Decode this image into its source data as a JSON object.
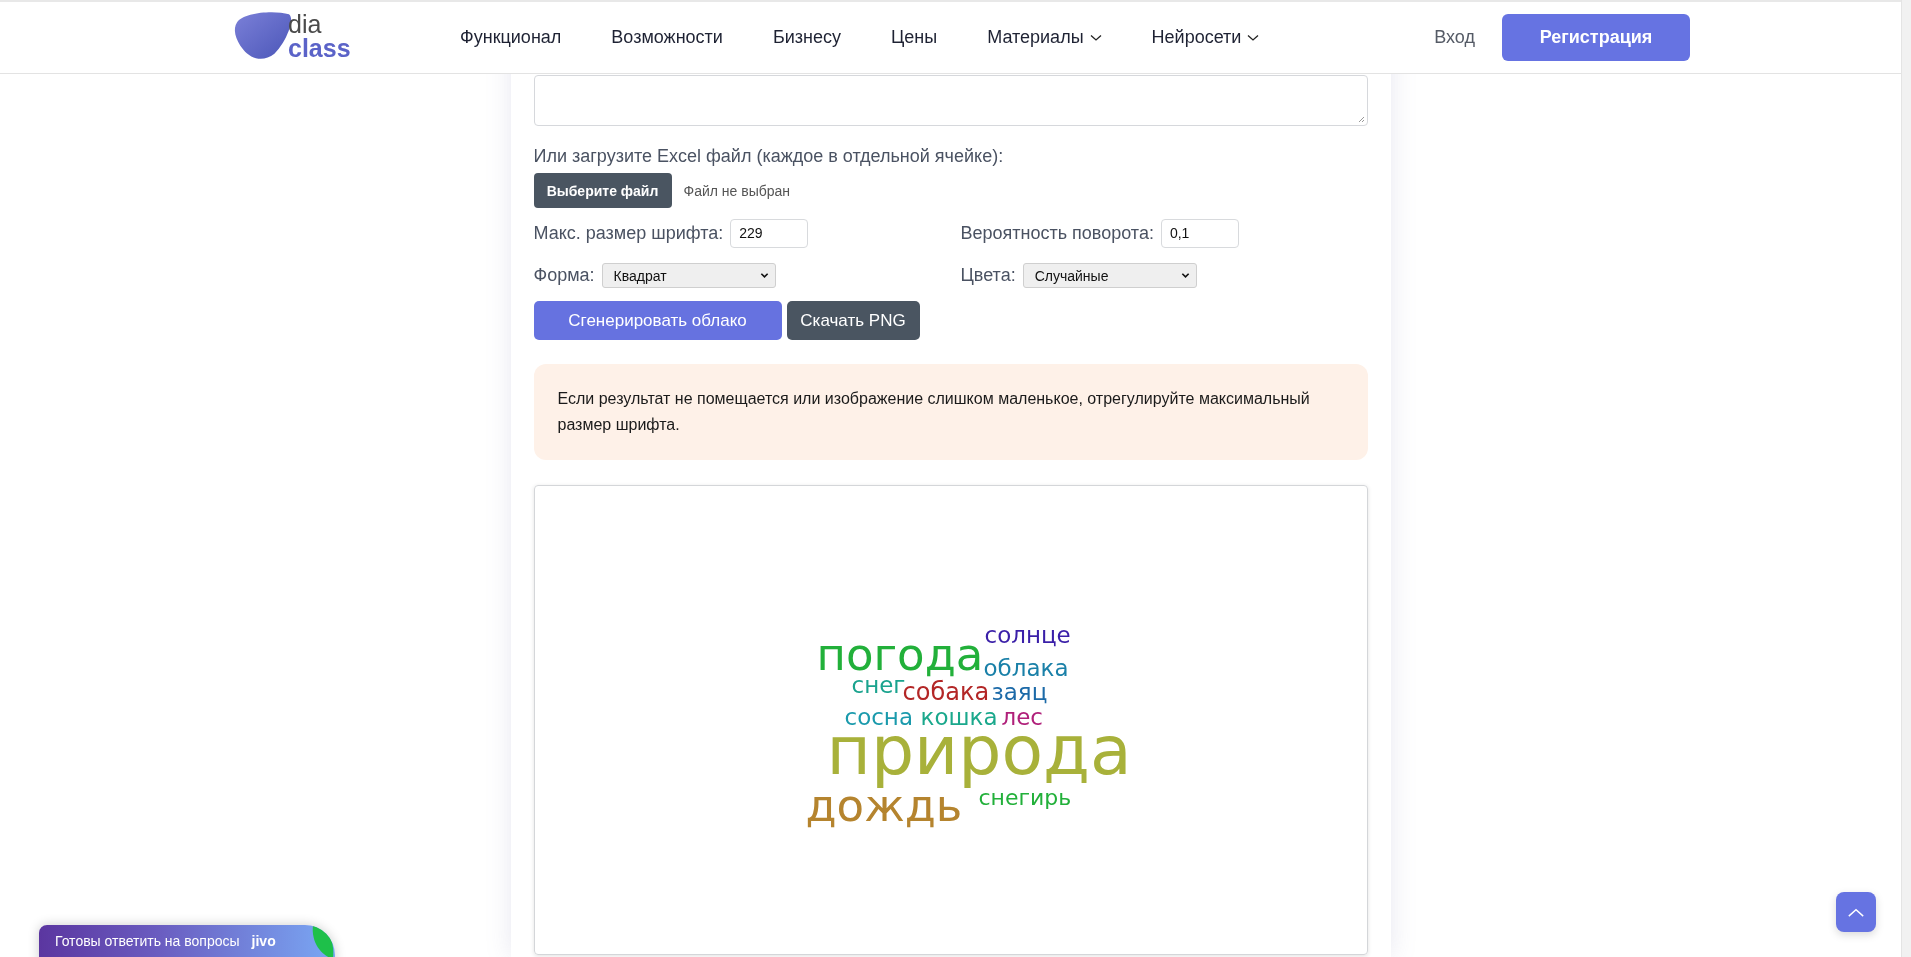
{
  "header": {
    "logo": {
      "line_1": "dia",
      "line_2": "class"
    },
    "nav": [
      {
        "label": "Функционал",
        "dropdown": false
      },
      {
        "label": "Возможности",
        "dropdown": false
      },
      {
        "label": "Бизнесу",
        "dropdown": false
      },
      {
        "label": "Цены",
        "dropdown": false
      },
      {
        "label": "Материалы",
        "dropdown": true
      },
      {
        "label": "Нейросети",
        "dropdown": true
      }
    ],
    "login": "Вход",
    "register": "Регистрация"
  },
  "form": {
    "upload_label": "Или загрузите Excel файл (каждое в отдельной ячейке):",
    "file_button": "Выберите файл",
    "file_status": "Файл не выбран",
    "fields": [
      {
        "label": "Макс. размер шрифта:",
        "kind": "input",
        "value": "229"
      },
      {
        "label": "Вероятность поворота:",
        "kind": "input",
        "value": "0,1"
      },
      {
        "label": "Форма:",
        "kind": "select",
        "value": "Квадрат"
      },
      {
        "label": "Цвета:",
        "kind": "select",
        "value": "Случайные"
      }
    ],
    "buttons": [
      {
        "label": "Сгенерировать облако",
        "kind": "primary"
      },
      {
        "label": "Скачать PNG",
        "kind": "secondary"
      }
    ]
  },
  "notice": "Если результат не помещается или изображение слишком маленькое, отрегулируйте максимальный размер шрифта.",
  "cloud": {
    "words": [
      {
        "text": "погода",
        "color": "#22b03a"
      },
      {
        "text": "солнце",
        "color": "#3a1fa8"
      },
      {
        "text": "облака",
        "color": "#1a80a8"
      },
      {
        "text": "снег",
        "color": "#1aa38e"
      },
      {
        "text": "собака",
        "color": "#b32626"
      },
      {
        "text": "заяц",
        "color": "#1c6aa8"
      },
      {
        "text": "сосна",
        "color": "#1a9aac"
      },
      {
        "text": "кошка",
        "color": "#1aa88c"
      },
      {
        "text": "лес",
        "color": "#b0207a"
      },
      {
        "text": "природа",
        "color": "#a8b13a"
      },
      {
        "text": "дождь",
        "color": "#b5842e"
      },
      {
        "text": "снегирь",
        "color": "#22b03a"
      }
    ]
  },
  "chat_widget": {
    "text": "Готовы ответить на вопросы",
    "brand": "jivo"
  }
}
